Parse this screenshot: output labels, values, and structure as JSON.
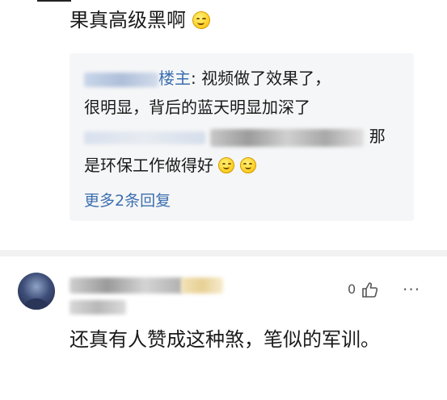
{
  "main_comment": {
    "text": "果真高级黑啊"
  },
  "reply": {
    "author_label": "楼主",
    "separator": ":",
    "line1_text": "视频做了效果了，",
    "line2_text": "很明显，背后的蓝天明显加深了",
    "line3_text": "那",
    "line4_text": "是环保工作做得好",
    "more_link": "更多2条回复"
  },
  "comment2": {
    "like_count": "0",
    "more_menu": "···",
    "body": "还真有人赞成这种煞，笔似的军训。"
  },
  "icons": {
    "emoji": "smiling-face-emoji",
    "like": "thumbs-up-icon",
    "more": "more-dots-icon"
  },
  "colors": {
    "link": "#3b6fb0",
    "reply_bg": "#f5f6f7",
    "divider": "#f2f2f2"
  }
}
